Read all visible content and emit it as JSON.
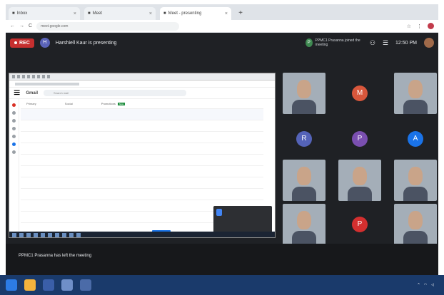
{
  "browser": {
    "tabs": [
      {
        "label": "Inbox",
        "active": false
      },
      {
        "label": "Meet",
        "active": false
      },
      {
        "label": "Meet - presenting",
        "active": true
      }
    ],
    "new_tab": "+",
    "url": "meet.google.com",
    "nav": {
      "back": "←",
      "forward": "→",
      "reload": "C"
    }
  },
  "meet": {
    "rec_label": "REC",
    "presenter_initial": "H",
    "presenting_text": "Harshiell Kaur is presenting",
    "notification_initial": "P",
    "notification_text": "PPMC1 Prasanna joined the meeting",
    "clock": "12:50 PM",
    "self_initial": "",
    "toast": "PPMC1 Prasanna has left the meeting",
    "participants": [
      {
        "type": "video",
        "name": ""
      },
      {
        "type": "letter",
        "letter": "M",
        "color": "#d8573c"
      },
      {
        "type": "video",
        "name": ""
      },
      {
        "type": "letter",
        "letter": "R",
        "color": "#5463b8"
      },
      {
        "type": "letter",
        "letter": "P",
        "color": "#7a4fb0"
      },
      {
        "type": "letter",
        "letter": "A",
        "color": "#1a73e8"
      },
      {
        "type": "video",
        "name": ""
      },
      {
        "type": "video",
        "name": ""
      },
      {
        "type": "video",
        "name": ""
      },
      {
        "type": "video",
        "name": ""
      },
      {
        "type": "letter",
        "letter": "P",
        "color": "#d32f2f"
      },
      {
        "type": "video",
        "name": ""
      }
    ]
  },
  "shared_screen": {
    "app": "Gmail",
    "search_placeholder": "Search mail",
    "tabs": [
      "Primary",
      "Social",
      "Promotions"
    ],
    "promo_tag": "New",
    "rows": [
      {
        "sender": "",
        "subject": "",
        "date": "",
        "unread": true
      },
      {
        "sender": "",
        "subject": "",
        "date": "",
        "unread": false
      },
      {
        "sender": "",
        "subject": "",
        "date": "",
        "unread": false
      },
      {
        "sender": "",
        "subject": "",
        "date": "",
        "unread": false
      },
      {
        "sender": "",
        "subject": "",
        "date": "",
        "unread": false
      },
      {
        "sender": "",
        "subject": "",
        "date": "",
        "unread": false
      },
      {
        "sender": "",
        "subject": "",
        "date": "",
        "unread": false
      },
      {
        "sender": "",
        "subject": "",
        "date": "",
        "unread": false
      },
      {
        "sender": "",
        "subject": "",
        "date": "",
        "unread": false
      },
      {
        "sender": "",
        "subject": "",
        "date": "",
        "unread": false
      }
    ]
  },
  "taskbar": {
    "tray_clock": "",
    "tray_date": ""
  },
  "colors": {
    "meet_bg": "#1f2125",
    "rec": "#c52f2f",
    "taskbar": "#1a3a6b"
  }
}
